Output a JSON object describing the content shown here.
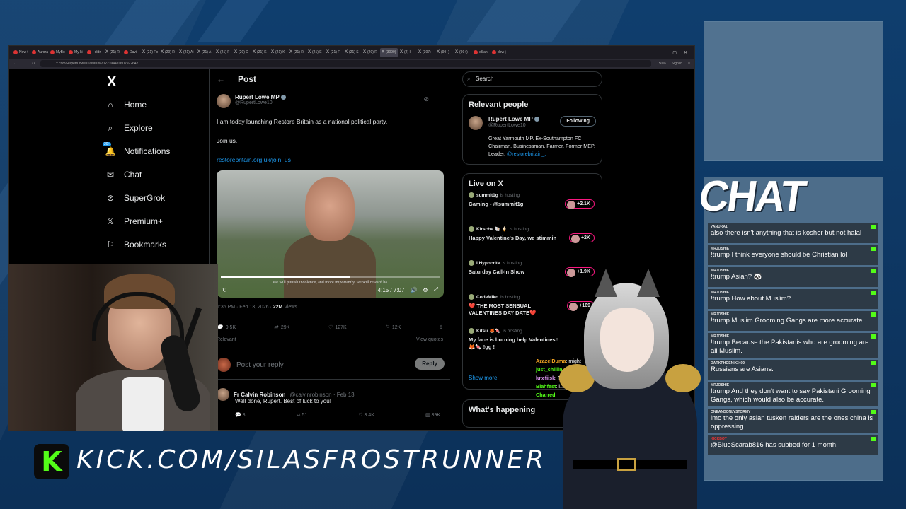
{
  "browser": {
    "tabs": [
      "New t",
      "Aurora",
      "MyBo",
      "My ki",
      "I didn",
      "(21) R",
      "Davi",
      "(21) Fo",
      "(20) R",
      "(21) Ai",
      "(21) A",
      "(21) F",
      "(20) D",
      "(21) K",
      "(21) K",
      "(21) R",
      "(21) E",
      "(21) F",
      "(21) S",
      "(20) R",
      "(3099)",
      "(2) I",
      "(307)",
      "(99+)",
      "(99+)",
      "eSan",
      "dow j"
    ],
    "url": "x.com/RupertLowe10/status/2022394470602922647",
    "zoom": "150%",
    "signin": "Sign in"
  },
  "nav": {
    "logo": "X",
    "items": [
      {
        "label": "Home",
        "icon": "home-icon",
        "glyph": "⌂"
      },
      {
        "label": "Explore",
        "icon": "search-icon",
        "glyph": "⌕"
      },
      {
        "label": "Notifications",
        "icon": "bell-icon",
        "glyph": "🔔"
      },
      {
        "label": "Chat",
        "icon": "mail-icon",
        "glyph": "✉"
      },
      {
        "label": "SuperGrok",
        "icon": "grok-icon",
        "glyph": "⊘"
      },
      {
        "label": "Premium+",
        "icon": "x-icon",
        "glyph": "𝕏"
      },
      {
        "label": "Bookmarks",
        "icon": "bookmark-icon",
        "glyph": "⚐"
      },
      {
        "label": "Creator Studio",
        "icon": "creator-icon",
        "glyph": "♙"
      }
    ],
    "notif_badge": "20+"
  },
  "post": {
    "header": "Post",
    "author_name": "Rupert Lowe MP",
    "author_handle": "@RupertLowe10",
    "text1": "I am today launching Restore Britain as a national political party.",
    "text2": "Join us.",
    "link": "restorebritain.org.uk/join_us",
    "video_subtitle": "We will punish indolence, and more importantly, we will reward ha",
    "video_time": "4:15 / 7:07",
    "video_progress": 0.59,
    "meta_time": "1:36 PM · Feb 13, 2026 · ",
    "views": "22M",
    "views_label": " Views",
    "stats": {
      "replies": "9.5K",
      "reposts": "29K",
      "likes": "127K",
      "bookmarks": "12K"
    },
    "relevant": "Relevant",
    "view_quotes": "View quotes",
    "reply_placeholder": "Post your reply",
    "reply_button": "Reply"
  },
  "reply": {
    "name": "Fr Calvin Robinson",
    "handle": "@calvinrobinson · Feb 13",
    "text": "Well done, Rupert. Best of luck to you!",
    "stats": {
      "replies": "8",
      "reposts": "51",
      "likes": "3.4K",
      "views": "39K"
    }
  },
  "sidebar": {
    "search_placeholder": "Search",
    "relevant_title": "Relevant people",
    "rp_name": "Rupert Lowe MP",
    "rp_handle": "@RupertLowe10",
    "following": "Following",
    "rp_bio": "Great Yarmouth MP. Ex-Southampton FC Chairman. Businessman. Farmer. Former MEP. Leader, ",
    "rp_bio_link": "@restorebritain_.",
    "live_title": "Live on X",
    "hosting": "is hosting",
    "live": [
      {
        "host": "summit1g",
        "title": "Gaming - @summit1g",
        "count": "+2.1K"
      },
      {
        "host": "Kirsche 🐚 🍦",
        "title": "Happy Valentine's Day, we stimmin",
        "count": "+2K"
      },
      {
        "host": "I,Hypocrite",
        "title": "Saturday Call-In Show",
        "count": "+1.9K"
      },
      {
        "host": "CodeMiko",
        "title": "❤️ THE MOST SENSUAL VALENTINES DAY DATE❤️",
        "count": "+169"
      },
      {
        "host": "Kitsu 🦊🍬",
        "title": "My face is burning help Valentines!! 🦊🍬 !gg !",
        "count": ""
      }
    ],
    "show_more": "Show more",
    "whats": "What's happening"
  },
  "overlay_chat": [
    {
      "user": "AzazelDuma",
      "text": ": might"
    },
    {
      "user": "just_chillin_killin_",
      "text": ": yes"
    },
    {
      "user": "lutefiisk",
      "text": ": There's a MUCH... of people accepting a n... n America(R..."
    },
    {
      "user": "Blahfest",
      "text": ": i... try"
    },
    {
      "user": "Charredl",
      "text": ""
    }
  ],
  "chat": {
    "title": "CHAT",
    "messages": [
      {
        "user": "YANUKA1",
        "text": "also there isn't anything that is kosher but not halal"
      },
      {
        "user": "MRJOSHIE",
        "text": "!trump I think everyone should be Christian lol"
      },
      {
        "user": "MRJOSHIE",
        "text": "!trump Asian? 🐼"
      },
      {
        "user": "MRJOSHIE",
        "text": "!trump How about Muslim?"
      },
      {
        "user": "MRJOSHIE",
        "text": "!trump Muslim Grooming Gangs are more accurate."
      },
      {
        "user": "MRJOSHIE",
        "text": "!trump Because the Pakistanis who are grooming are all Muslim."
      },
      {
        "user": "DARKPHOENIX3400",
        "text": "Russians are Asians."
      },
      {
        "user": "MRJOSHIE",
        "text": "!trump And they don't want to say Pakistani Grooming Gangs, which would also be accurate."
      },
      {
        "user": "ONEANDONLYSTORMY",
        "text": "imo the only asian tusken raiders are the ones china is oppressing"
      },
      {
        "user": "KICKBOT",
        "text": "@BlueScarab816 has subbed for 1 month!",
        "red": true
      }
    ]
  },
  "brand": {
    "logo": "K",
    "url": "KICK.COM/SILASFROSTRUNNER"
  }
}
